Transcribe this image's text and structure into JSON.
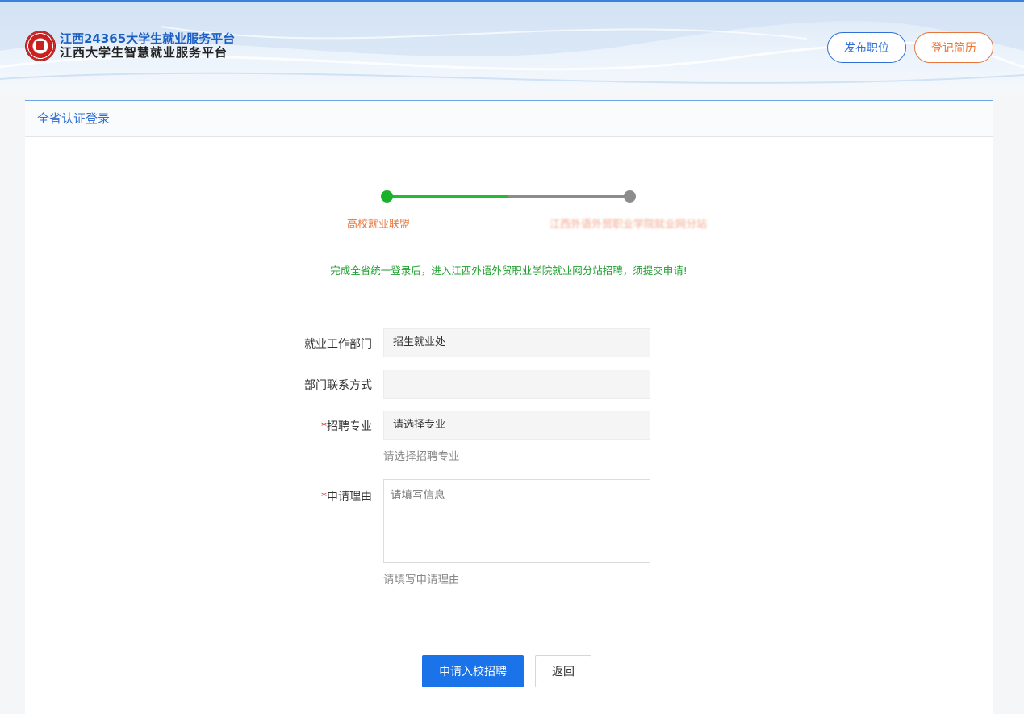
{
  "header": {
    "brand_line1": "江西24365大学生就业服务平台",
    "brand_line2": "江西大学生智慧就业服务平台",
    "post_job_label": "发布职位",
    "register_resume_label": "登记简历"
  },
  "panel": {
    "title": "全省认证登录"
  },
  "steps": {
    "items": [
      {
        "label": "高校就业联盟",
        "status": "done"
      },
      {
        "label": "江西外语外贸职业学院就业网分站",
        "status": "pending"
      }
    ]
  },
  "notice": "完成全省统一登录后，进入江西外语外贸职业学院就业网分站招聘，须提交申请!",
  "form": {
    "department": {
      "label": "就业工作部门",
      "value": "招生就业处"
    },
    "contact": {
      "label": "部门联系方式",
      "value": ""
    },
    "major": {
      "required_mark": "*",
      "label": "招聘专业",
      "value": "请选择专业",
      "hint": "请选择招聘专业"
    },
    "reason": {
      "required_mark": "*",
      "label": "申请理由",
      "placeholder": "请填写信息",
      "hint": "请填写申请理由"
    }
  },
  "actions": {
    "submit_label": "申请入校招聘",
    "back_label": "返回"
  },
  "colors": {
    "primary_blue": "#1a73e8",
    "accent_orange": "#e8753a",
    "success_green": "#22a030"
  }
}
